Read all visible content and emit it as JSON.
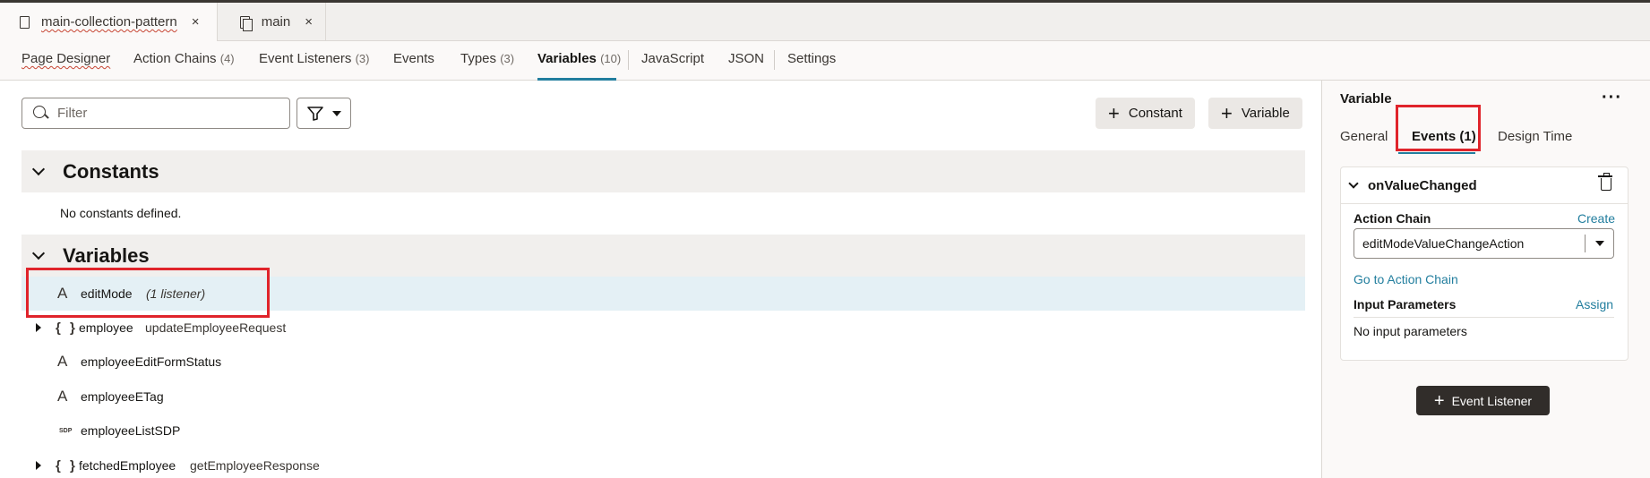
{
  "file_tabs": [
    {
      "label": "main-collection-pattern",
      "close": "×"
    },
    {
      "label": "main",
      "close": "×"
    }
  ],
  "designer_tabs": [
    {
      "label": "Page Designer",
      "count": ""
    },
    {
      "label": "Action Chains",
      "count": "(4)"
    },
    {
      "label": "Event Listeners",
      "count": "(3)"
    },
    {
      "label": "Events",
      "count": ""
    },
    {
      "label": "Types",
      "count": "(3)"
    },
    {
      "label": "Variables",
      "count": "(10)"
    },
    {
      "label": "JavaScript",
      "count": ""
    },
    {
      "label": "JSON",
      "count": ""
    },
    {
      "label": "Settings",
      "count": ""
    }
  ],
  "toolbar": {
    "filter_placeholder": "Filter",
    "filter_value": "",
    "constant_label": "Constant",
    "variable_label": "Variable"
  },
  "constants": {
    "title": "Constants",
    "empty_message": "No constants defined."
  },
  "variables": {
    "title": "Variables",
    "rows": [
      {
        "icon": "A",
        "name": "editMode",
        "extra": "(1 listener)",
        "type": ""
      },
      {
        "icon": "{ }",
        "name": "employee",
        "extra": "",
        "type": "updateEmployeeRequest"
      },
      {
        "icon": "A",
        "name": "employeeEditFormStatus",
        "extra": "",
        "type": ""
      },
      {
        "icon": "A",
        "name": "employeeETag",
        "extra": "",
        "type": ""
      },
      {
        "icon": "SDP",
        "name": "employeeListSDP",
        "extra": "",
        "type": ""
      },
      {
        "icon": "{ }",
        "name": "fetchedEmployee",
        "extra": "",
        "type": "getEmployeeResponse"
      }
    ]
  },
  "panel": {
    "title": "Variable",
    "more": "···",
    "tabs": [
      "General",
      "Events (1)",
      "Design Time"
    ],
    "event": {
      "name": "onValueChanged",
      "action_chain_label": "Action Chain",
      "create_link": "Create",
      "action_chain_value": "editModeValueChangeAction",
      "go_to_link": "Go to Action Chain",
      "input_params_label": "Input Parameters",
      "assign_link": "Assign",
      "no_params": "No input parameters"
    },
    "add_listener_label": "Event Listener"
  },
  "colors": {
    "accent": "#227e9e",
    "highlight_box": "#e0242b",
    "selected_row": "#e4f0f5",
    "primary_button": "#312d2a"
  }
}
